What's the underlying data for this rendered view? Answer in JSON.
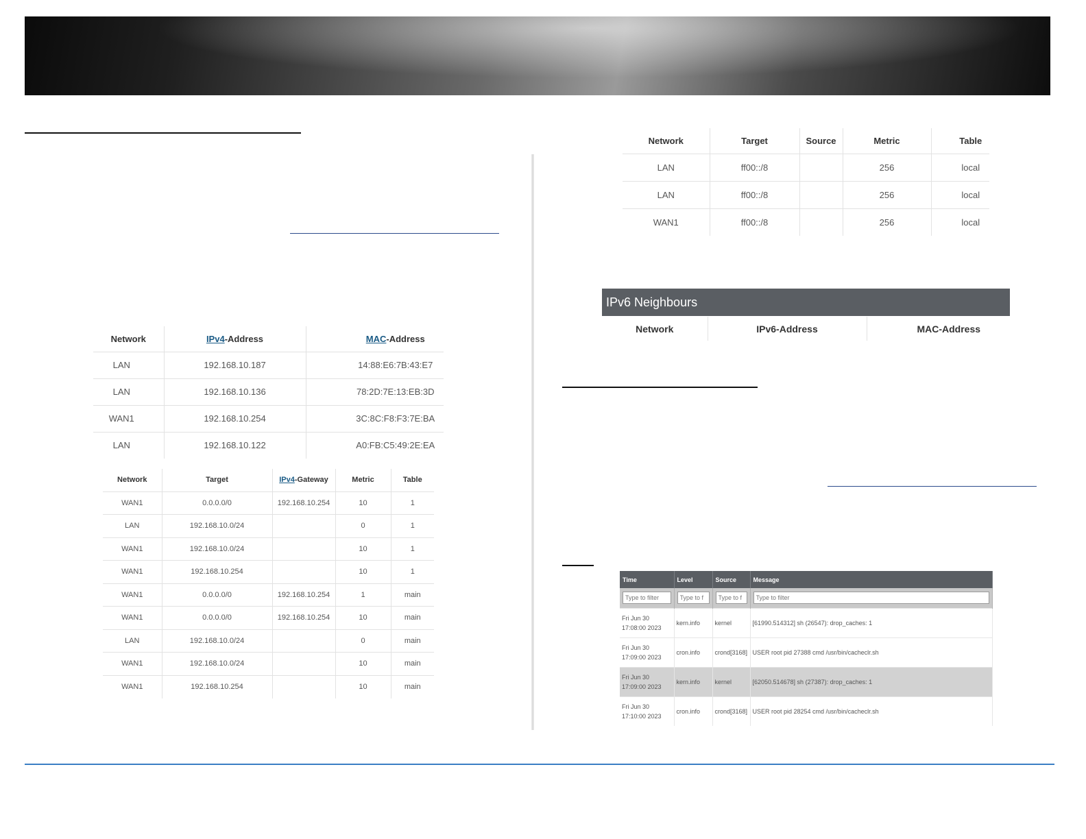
{
  "arp": {
    "headers": {
      "network": "Network",
      "ipv4_link": "IPv4",
      "ipv4_rest": "-Address",
      "mac_link": "MAC",
      "mac_rest": "-Address"
    },
    "rows": [
      [
        "LAN",
        "192.168.10.187",
        "14:88:E6:7B:43:E7"
      ],
      [
        "LAN",
        "192.168.10.136",
        "78:2D:7E:13:EB:3D"
      ],
      [
        "WAN1",
        "192.168.10.254",
        "3C:8C:F8:F3:7E:BA"
      ],
      [
        "LAN",
        "192.168.10.122",
        "A0:FB:C5:49:2E:EA"
      ]
    ]
  },
  "routes": {
    "headers": {
      "network": "Network",
      "target": "Target",
      "gw_link": "IPv4",
      "gw_rest": "-Gateway",
      "metric": "Metric",
      "table": "Table"
    },
    "rows": [
      [
        "WAN1",
        "0.0.0.0/0",
        "192.168.10.254",
        "10",
        "1"
      ],
      [
        "LAN",
        "192.168.10.0/24",
        "",
        "0",
        "1"
      ],
      [
        "WAN1",
        "192.168.10.0/24",
        "",
        "10",
        "1"
      ],
      [
        "WAN1",
        "192.168.10.254",
        "",
        "10",
        "1"
      ],
      [
        "WAN1",
        "0.0.0.0/0",
        "192.168.10.254",
        "1",
        "main"
      ],
      [
        "WAN1",
        "0.0.0.0/0",
        "192.168.10.254",
        "10",
        "main"
      ],
      [
        "LAN",
        "192.168.10.0/24",
        "",
        "0",
        "main"
      ],
      [
        "WAN1",
        "192.168.10.0/24",
        "",
        "10",
        "main"
      ],
      [
        "WAN1",
        "192.168.10.254",
        "",
        "10",
        "main"
      ]
    ]
  },
  "routes6": {
    "headers": {
      "network": "Network",
      "target": "Target",
      "source": "Source",
      "metric": "Metric",
      "table": "Table"
    },
    "rows": [
      [
        "LAN",
        "ff00::/8",
        "",
        "256",
        "local"
      ],
      [
        "LAN",
        "ff00::/8",
        "",
        "256",
        "local"
      ],
      [
        "WAN1",
        "ff00::/8",
        "",
        "256",
        "local"
      ]
    ]
  },
  "neighbours": {
    "title": "IPv6 Neighbours",
    "headers": {
      "network": "Network",
      "ipv6": "IPv6-Address",
      "mac": "MAC-Address"
    }
  },
  "syslog": {
    "headers": {
      "time": "Time",
      "level": "Level",
      "source": "Source",
      "message": "Message"
    },
    "filters": {
      "time": "Type to filter",
      "level": "Type to f",
      "source": "Type to f",
      "message": "Type to filter"
    },
    "rows": [
      {
        "time": "Fri Jun 30 17:08:00 2023",
        "level": "kern.info",
        "source": "kernel",
        "message": "[61990.514312] sh (26547): drop_caches: 1"
      },
      {
        "time": "Fri Jun 30 17:09:00 2023",
        "level": "cron.info",
        "source": "crond[3168]",
        "message": "USER root pid 27388 cmd /usr/bin/cacheclr.sh"
      },
      {
        "time": "Fri Jun 30 17:09:00 2023",
        "level": "kern.info",
        "source": "kernel",
        "message": "[62050.514678] sh (27387): drop_caches: 1"
      },
      {
        "time": "Fri Jun 30 17:10:00 2023",
        "level": "cron.info",
        "source": "crond[3168]",
        "message": "USER root pid 28254 cmd /usr/bin/cacheclr.sh"
      }
    ]
  }
}
